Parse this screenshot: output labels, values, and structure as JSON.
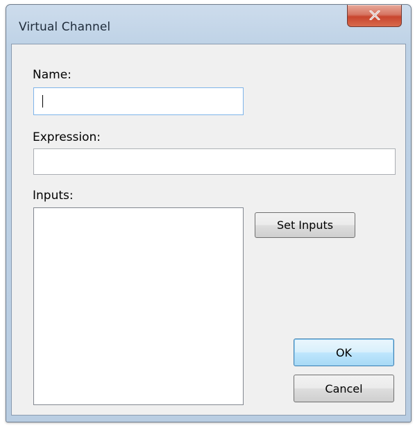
{
  "window": {
    "title": "Virtual Channel"
  },
  "form": {
    "name_label": "Name:",
    "name_value": "",
    "expression_label": "Expression:",
    "expression_value": "",
    "inputs_label": "Inputs:",
    "inputs_items": []
  },
  "buttons": {
    "set_inputs": "Set Inputs",
    "ok": "OK",
    "cancel": "Cancel"
  },
  "icons": {
    "close": "close-icon"
  }
}
